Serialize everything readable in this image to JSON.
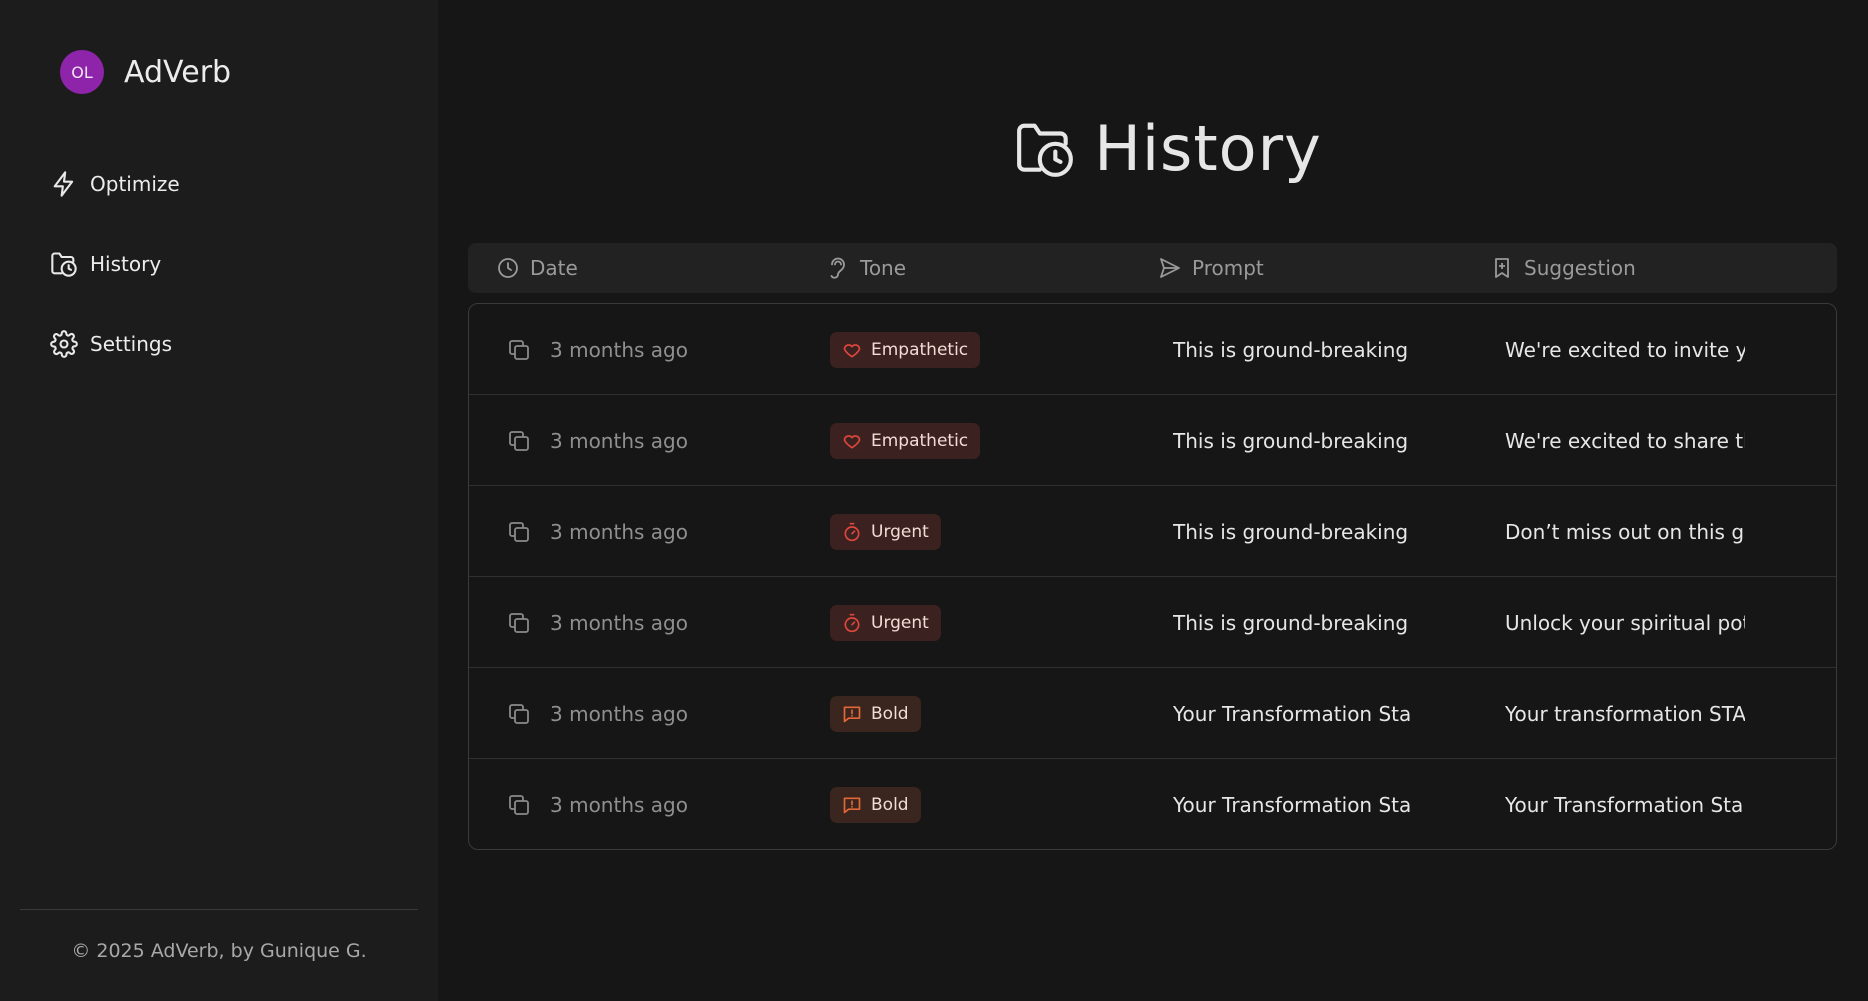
{
  "brand": {
    "initials": "OL",
    "name": "AdVerb"
  },
  "nav": [
    {
      "label": "Optimize",
      "icon": "zap-icon"
    },
    {
      "label": "History",
      "icon": "folder-clock-icon"
    },
    {
      "label": "Settings",
      "icon": "gear-icon"
    }
  ],
  "footer": "© 2025 AdVerb, by Gunique G.",
  "page": {
    "title": "History",
    "icon": "folder-clock-icon"
  },
  "table": {
    "columns": {
      "date": "Date",
      "tone": "Tone",
      "prompt": "Prompt",
      "suggestion": "Suggestion"
    },
    "rows": [
      {
        "date": "3 months ago",
        "tone": "Empathetic",
        "tone_icon": "heart-icon",
        "prompt": "This is ground-breaking",
        "suggestion": "We're excited to invite yo"
      },
      {
        "date": "3 months ago",
        "tone": "Empathetic",
        "tone_icon": "heart-icon",
        "prompt": "This is ground-breaking",
        "suggestion": "We're excited to share th"
      },
      {
        "date": "3 months ago",
        "tone": "Urgent",
        "tone_icon": "timer-icon",
        "prompt": "This is ground-breaking",
        "suggestion": "Don’t miss out on this go"
      },
      {
        "date": "3 months ago",
        "tone": "Urgent",
        "tone_icon": "timer-icon",
        "prompt": "This is ground-breaking",
        "suggestion": "Unlock your spiritual pot"
      },
      {
        "date": "3 months ago",
        "tone": "Bold",
        "tone_icon": "message-alert-icon",
        "prompt": "Your Transformation Sta",
        "suggestion": "Your transformation STA"
      },
      {
        "date": "3 months ago",
        "tone": "Bold",
        "tone_icon": "message-alert-icon",
        "prompt": "Your Transformation Sta",
        "suggestion": "Your Transformation Sta"
      }
    ]
  },
  "colors": {
    "background": "#161616",
    "sidebar": "#1c1c1c",
    "avatar": "#8e24aa",
    "tone_red": "#e0473c",
    "tone_orange": "#e2683a"
  }
}
